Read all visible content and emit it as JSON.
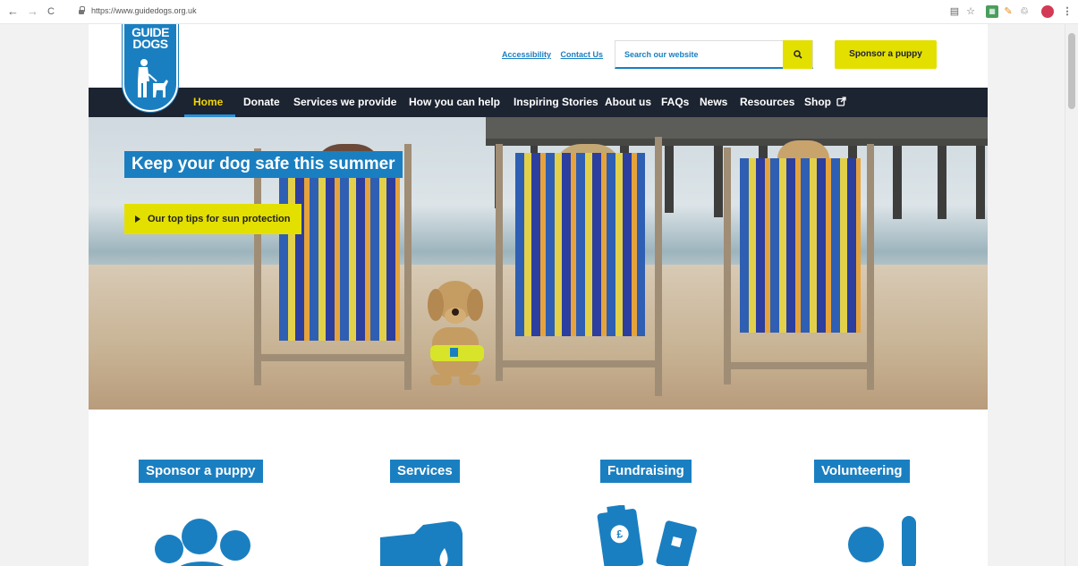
{
  "browser": {
    "back_glyph": "←",
    "forward_glyph": "→",
    "reload_glyph": "C",
    "url": "https://www.guidedogs.org.uk",
    "icons": [
      "translate-icon",
      "star-icon",
      "extension-icon",
      "pin-icon",
      "recycle-icon",
      "profile-icon",
      "menu-icon"
    ]
  },
  "logo": {
    "text": "GUIDE\nDOGS"
  },
  "header": {
    "accessibility_link": "Accessibility",
    "contact_link": "Contact Us",
    "search_placeholder": "Search our website",
    "sponsor_button": "Sponsor a puppy"
  },
  "nav": {
    "items": [
      {
        "label": "Home",
        "active": true
      },
      {
        "label": "Donate"
      },
      {
        "label": "Services we provide"
      },
      {
        "label": "How you can help"
      },
      {
        "label": "Inspiring Stories"
      },
      {
        "label": "About us"
      },
      {
        "label": "FAQs"
      },
      {
        "label": "News"
      },
      {
        "label": "Resources"
      },
      {
        "label": "Shop"
      }
    ]
  },
  "hero": {
    "headline": "Keep your dog safe this summer",
    "cta": "Our top tips for sun protection"
  },
  "cards": [
    {
      "title": "Sponsor a puppy",
      "icon": "paw-icon"
    },
    {
      "title": "Services",
      "icon": "guide-harness-icon"
    },
    {
      "title": "Fundraising",
      "icon": "collection-tin-icon"
    },
    {
      "title": "Volunteering",
      "icon": "raised-hand-icon"
    }
  ],
  "colors": {
    "brand_blue": "#1a7fc1",
    "accent_yellow": "#e3e000",
    "nav_bg": "#1c2331",
    "nav_active": "#f2d600"
  }
}
